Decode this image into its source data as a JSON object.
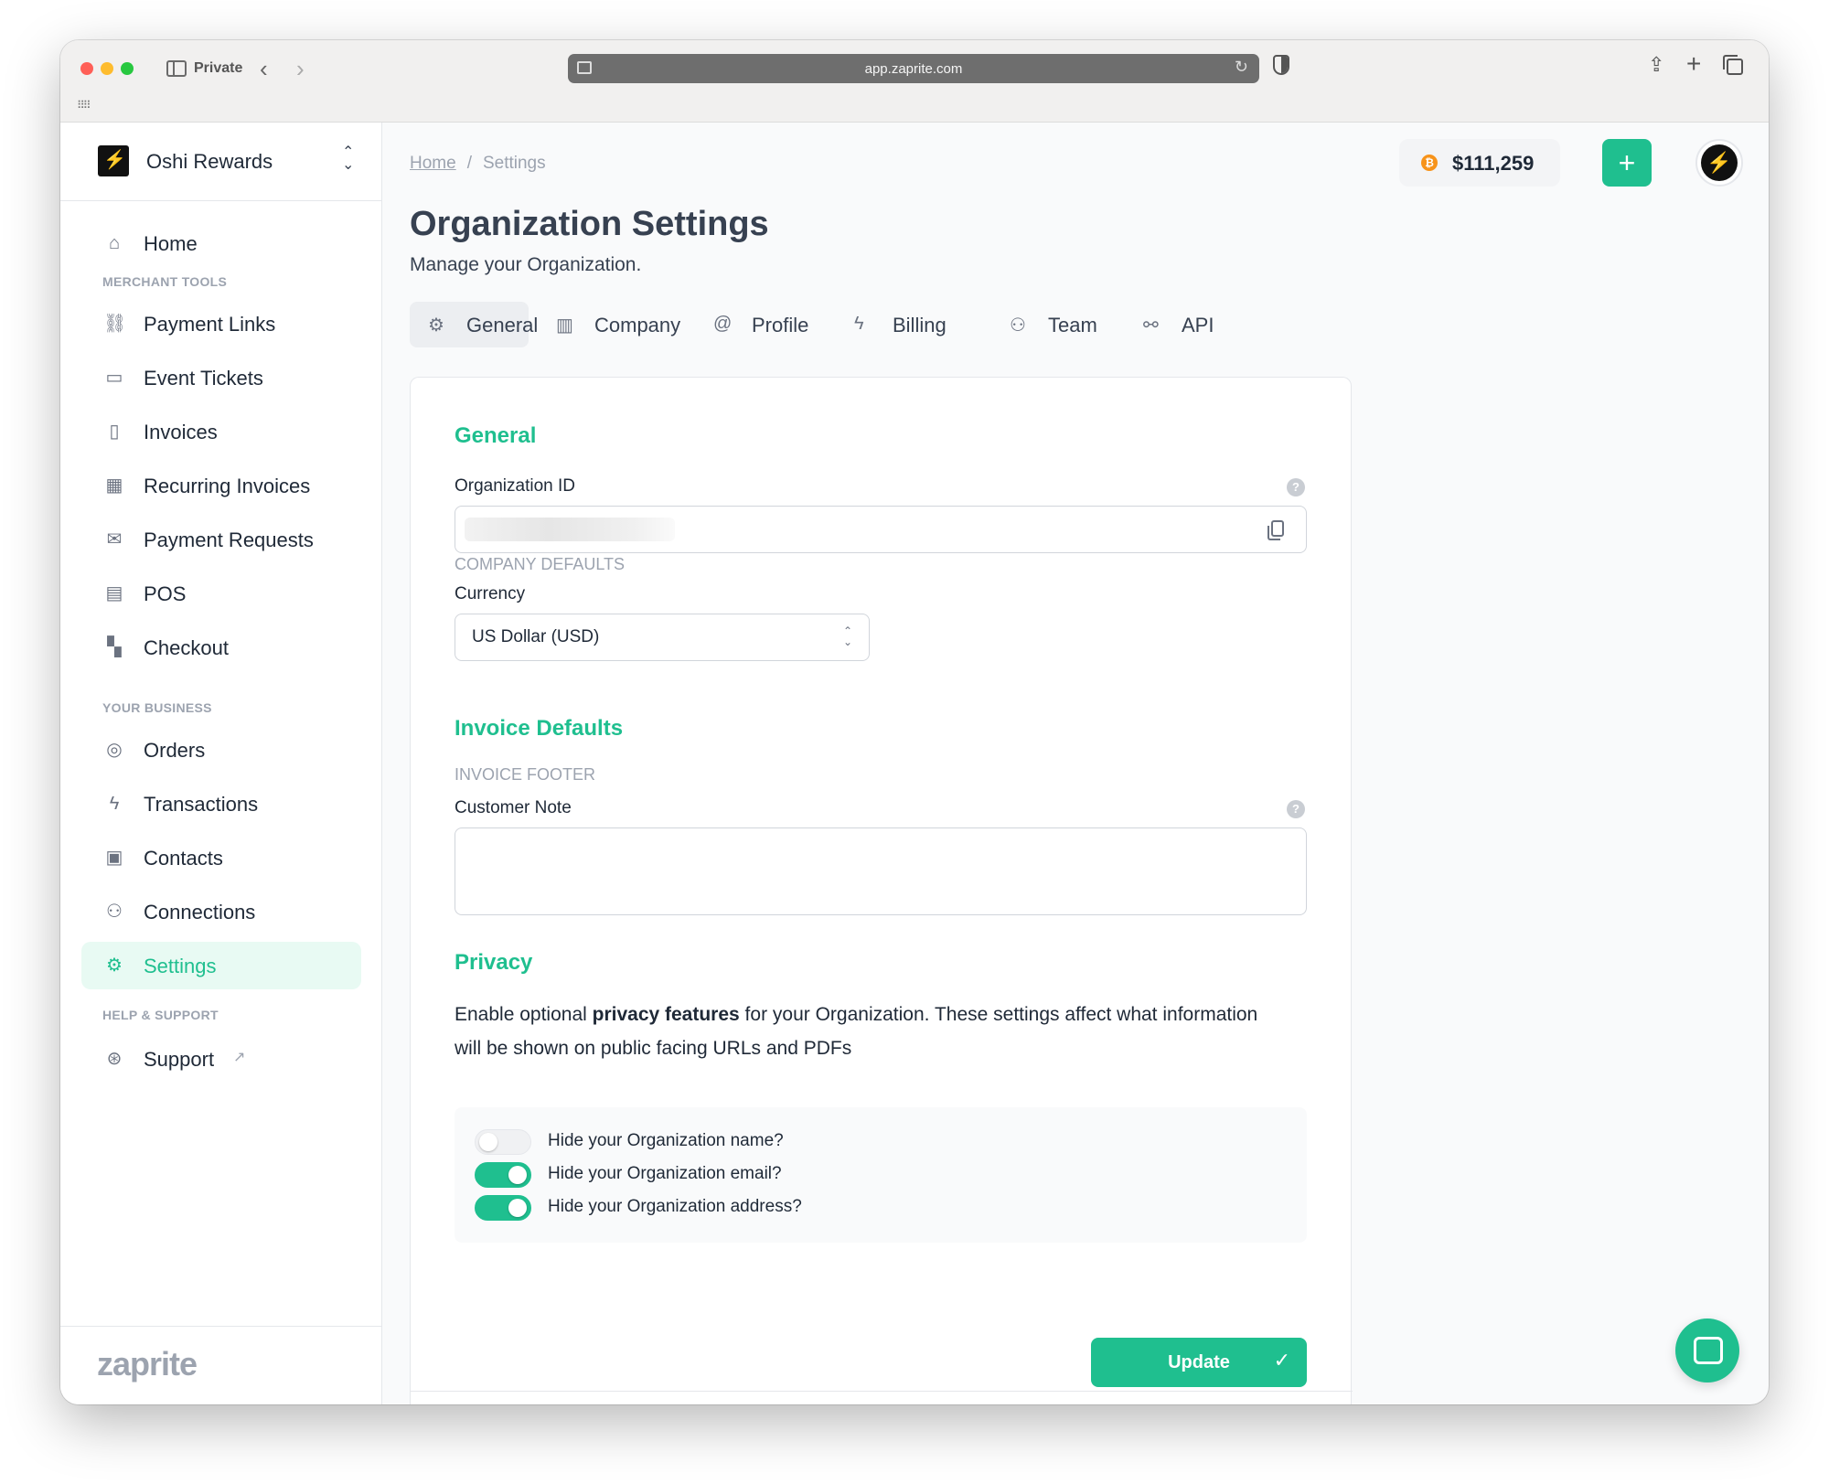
{
  "browser": {
    "private_label": "Private",
    "url": "app.zaprite.com"
  },
  "sidebar": {
    "org_name": "Oshi Rewards",
    "home_label": "Home",
    "merchant_tools_label": "MERCHANT TOOLS",
    "merchant_items": [
      "Payment Links",
      "Event Tickets",
      "Invoices",
      "Recurring Invoices",
      "Payment Requests",
      "POS",
      "Checkout"
    ],
    "your_business_label": "YOUR BUSINESS",
    "business_items": [
      "Orders",
      "Transactions",
      "Contacts",
      "Connections",
      "Settings"
    ],
    "help_label": "HELP & SUPPORT",
    "support_label": "Support",
    "brand": "zaprite"
  },
  "header": {
    "breadcrumb": [
      "Home",
      "Settings"
    ],
    "balance": "$111,259",
    "btc_symbol": "₿"
  },
  "page": {
    "title": "Organization Settings",
    "subtitle": "Manage your Organization."
  },
  "tabs": [
    "General",
    "Company",
    "Profile",
    "Billing",
    "Team",
    "API"
  ],
  "form": {
    "general_title": "General",
    "org_id_label": "Organization ID",
    "company_defaults_label": "COMPANY DEFAULTS",
    "currency_label": "Currency",
    "currency_value": "US Dollar (USD)",
    "invoice_defaults_title": "Invoice Defaults",
    "invoice_footer_label": "INVOICE FOOTER",
    "customer_note_label": "Customer Note",
    "privacy_title": "Privacy",
    "privacy_text_before": "Enable optional ",
    "privacy_text_bold": "privacy features",
    "privacy_text_after": " for your Organization. These settings affect what information will be shown on public facing URLs and PDFs",
    "toggles": [
      {
        "label": "Hide your Organization name?",
        "on": false
      },
      {
        "label": "Hide your Organization email?",
        "on": true
      },
      {
        "label": "Hide your Organization address?",
        "on": true
      }
    ],
    "update_label": "Update"
  },
  "colors": {
    "accent": "#1fbf8f",
    "bitcoin": "#f7931a"
  }
}
